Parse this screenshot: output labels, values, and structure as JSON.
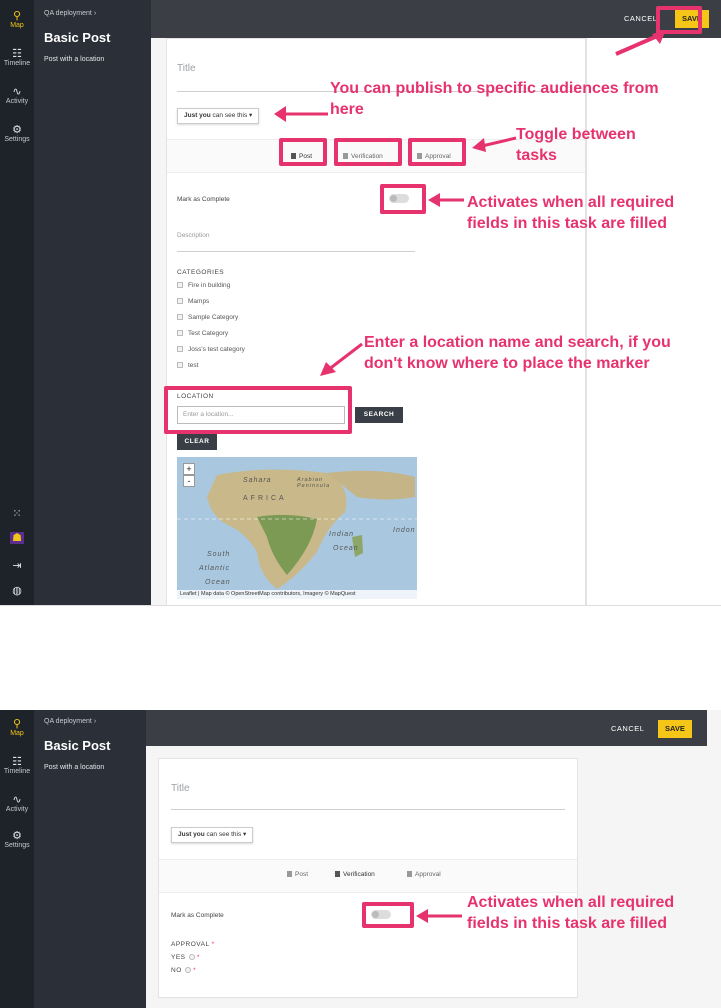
{
  "rail": {
    "map": "Map",
    "timeline": "Timeline",
    "activity": "Activity",
    "settings": "Settings"
  },
  "post": {
    "breadcrumb": "QA deployment",
    "title": "Basic Post",
    "subtitle": "Post with a location"
  },
  "toolbar": {
    "cancel": "CANCEL",
    "save": "SAVE"
  },
  "form": {
    "title_placeholder": "Title",
    "audience_bold": "Just you",
    "audience_rest": " can see this",
    "tabs": [
      "Post",
      "Verification",
      "Approval"
    ],
    "mark_complete": "Mark as Complete",
    "description_placeholder": "Description",
    "categories_label": "CATEGORIES",
    "categories": [
      "Fire in building",
      "Mamps",
      "Sample Category",
      "Test Category",
      "Joss's test category",
      "test"
    ],
    "location_label": "LOCATION",
    "location_placeholder": "Enter a location...",
    "search": "SEARCH",
    "clear": "CLEAR",
    "zoom_in": "+",
    "zoom_out": "-",
    "map_labels": [
      "Sahara",
      "Arabian Peninsula",
      "AFRICA",
      "Indian",
      "Ocean",
      "South",
      "Atlantic",
      "Ocean",
      "Indon"
    ],
    "map_attribution": "Leaflet | Map data © OpenStreetMap contributors, Imagery © MapQuest"
  },
  "form2": {
    "approval_label": "APPROVAL",
    "yes": "YES",
    "no": "NO",
    "required_mark": "*"
  },
  "annotations": {
    "audiences": "You can publish to specific audiences from here",
    "toggle_tasks": "Toggle between tasks",
    "activates": "Activates when all required fields in this task are filled",
    "location": "Enter a location name and search, if you don't know where to place the marker",
    "activates2": "Activates when all required fields in this task are filled"
  },
  "colors": {
    "annotation": "#e6336e",
    "save": "#f5c518",
    "active_nav": "#f0c419"
  }
}
